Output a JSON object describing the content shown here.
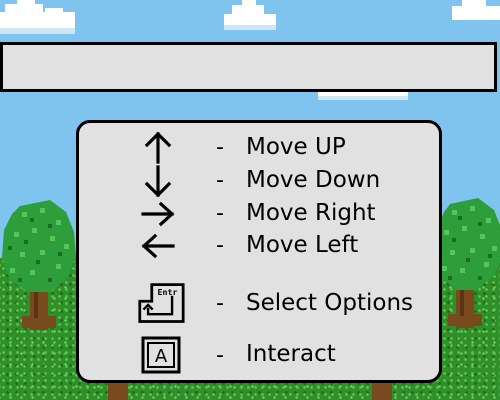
{
  "title_bar": {
    "text": ""
  },
  "controls": [
    {
      "icon": "arrow-up-icon",
      "separator": "-",
      "label": "Move UP"
    },
    {
      "icon": "arrow-down-icon",
      "separator": "-",
      "label": "Move Down"
    },
    {
      "icon": "arrow-right-icon",
      "separator": "-",
      "label": "Move Right"
    },
    {
      "icon": "arrow-left-icon",
      "separator": "-",
      "label": "Move Left"
    },
    {
      "icon": "enter-key-icon",
      "icon_text": "Entr",
      "separator": "-",
      "label": "Select Options"
    },
    {
      "icon": "a-key-icon",
      "icon_text": "A",
      "separator": "-",
      "label": "Interact"
    }
  ],
  "colors": {
    "sky": "#7fc4ee",
    "cloud": "#ffffff",
    "grass": "#2f8f2a",
    "tree_leaves": "#2e9e3a",
    "tree_trunk": "#7a4a1f",
    "panel": "#e1e1e1",
    "border": "#000000"
  }
}
